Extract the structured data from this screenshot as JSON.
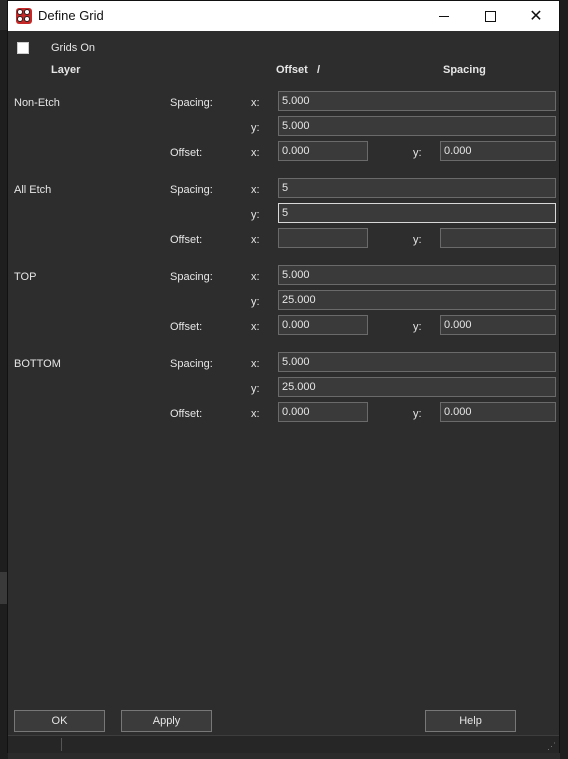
{
  "window": {
    "title": "Define Grid",
    "app_icon": "app-logo-icon",
    "controls": [
      "minimize-icon",
      "maximize-icon",
      "close-icon"
    ]
  },
  "grids_on": {
    "label": "Grids On",
    "checked": false
  },
  "headers": {
    "layer": "Layer",
    "offset": "Offset",
    "slash": "/",
    "spacing": "Spacing"
  },
  "labels": {
    "spacing": "Spacing:",
    "offset": "Offset:",
    "x": "x:",
    "y": "y:"
  },
  "layers": [
    {
      "name": "Non-Etch",
      "spacing_x": "5.000",
      "spacing_y": "5.000",
      "offset_x": "0.000",
      "offset_y": "0.000"
    },
    {
      "name": "All Etch",
      "spacing_x": "5",
      "spacing_y": "5",
      "offset_x": "",
      "offset_y": ""
    },
    {
      "name": "TOP",
      "spacing_x": "5.000",
      "spacing_y": "25.000",
      "offset_x": "0.000",
      "offset_y": "0.000"
    },
    {
      "name": "BOTTOM",
      "spacing_x": "5.000",
      "spacing_y": "25.000",
      "offset_x": "0.000",
      "offset_y": "0.000"
    }
  ],
  "buttons": {
    "ok": "OK",
    "apply": "Apply",
    "help": "Help"
  },
  "colors": {
    "background": "#2d2d2d",
    "field": "#3a3a3a",
    "titlebar": "#ffffff",
    "icon_red": "#c62828"
  }
}
